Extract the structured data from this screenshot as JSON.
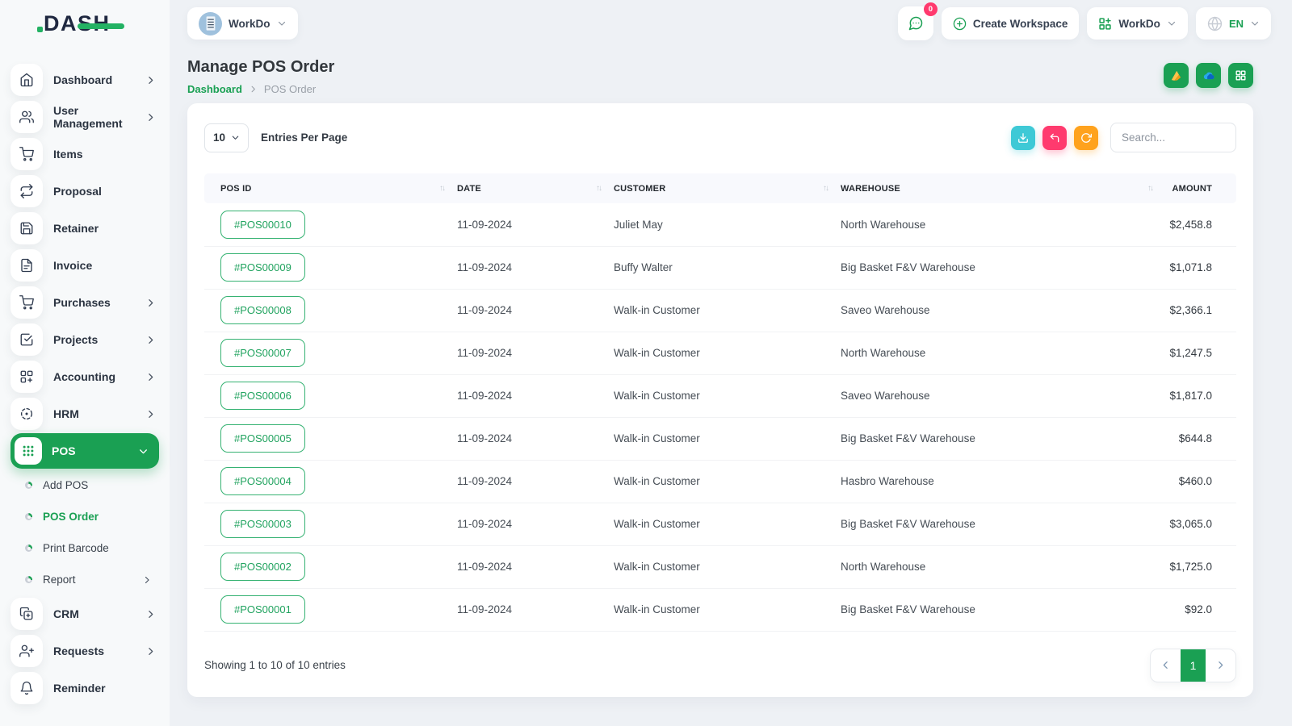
{
  "brand": {
    "logo_text": "DASH"
  },
  "topbar": {
    "workspace_switcher": {
      "label": "WorkDo",
      "avatar_icon": "building-icon"
    },
    "messages_badge": "0",
    "create_workspace_label": "Create Workspace",
    "company_dropdown_label": "WorkDo",
    "language": "EN"
  },
  "sidebar": {
    "items": [
      {
        "label": "Dashboard",
        "icon": "home-icon",
        "has_chevron": true
      },
      {
        "label": "User Management",
        "icon": "users-icon",
        "has_chevron": true
      },
      {
        "label": "Items",
        "icon": "cart-icon",
        "has_chevron": false
      },
      {
        "label": "Proposal",
        "icon": "repeat-icon",
        "has_chevron": false
      },
      {
        "label": "Retainer",
        "icon": "save-icon",
        "has_chevron": false
      },
      {
        "label": "Invoice",
        "icon": "file-icon",
        "has_chevron": false
      },
      {
        "label": "Purchases",
        "icon": "cart-icon",
        "has_chevron": true
      },
      {
        "label": "Projects",
        "icon": "check-square-icon",
        "has_chevron": true
      },
      {
        "label": "Accounting",
        "icon": "grid-plus-icon",
        "has_chevron": true
      },
      {
        "label": "HRM",
        "icon": "target-icon",
        "has_chevron": true
      },
      {
        "label": "POS",
        "icon": "grid-dots-icon",
        "has_chevron": true,
        "active": true
      }
    ],
    "pos_submenu": [
      {
        "label": "Add POS",
        "active": false
      },
      {
        "label": "POS Order",
        "active": true
      },
      {
        "label": "Print Barcode",
        "active": false
      },
      {
        "label": "Report",
        "active": false,
        "has_chevron": true
      }
    ],
    "items_bottom": [
      {
        "label": "CRM",
        "icon": "copy-plus-icon",
        "has_chevron": true
      },
      {
        "label": "Requests",
        "icon": "user-plus-icon",
        "has_chevron": true
      },
      {
        "label": "Reminder",
        "icon": "bell-icon",
        "has_chevron": false
      }
    ]
  },
  "page": {
    "title": "Manage POS Order",
    "breadcrumb": [
      "Dashboard",
      "POS Order"
    ],
    "header_buttons": [
      "google-drive-icon",
      "onedrive-icon",
      "grid-view-icon"
    ]
  },
  "toolbar": {
    "entries_per_page_value": "10",
    "entries_per_page_label": "Entries Per Page",
    "search_placeholder": "Search...",
    "buttons": [
      "download-icon",
      "undo-icon",
      "refresh-icon"
    ]
  },
  "table": {
    "columns": [
      "POS ID",
      "DATE",
      "CUSTOMER",
      "WAREHOUSE",
      "AMOUNT"
    ],
    "rows": [
      {
        "pos_id": "#POS00010",
        "date": "11-09-2024",
        "customer": "Juliet May",
        "warehouse": "North Warehouse",
        "amount": "$2,458.8"
      },
      {
        "pos_id": "#POS00009",
        "date": "11-09-2024",
        "customer": "Buffy Walter",
        "warehouse": "Big Basket F&V Warehouse",
        "amount": "$1,071.8"
      },
      {
        "pos_id": "#POS00008",
        "date": "11-09-2024",
        "customer": "Walk-in Customer",
        "warehouse": "Saveo Warehouse",
        "amount": "$2,366.1"
      },
      {
        "pos_id": "#POS00007",
        "date": "11-09-2024",
        "customer": "Walk-in Customer",
        "warehouse": "North Warehouse",
        "amount": "$1,247.5"
      },
      {
        "pos_id": "#POS00006",
        "date": "11-09-2024",
        "customer": "Walk-in Customer",
        "warehouse": "Saveo Warehouse",
        "amount": "$1,817.0"
      },
      {
        "pos_id": "#POS00005",
        "date": "11-09-2024",
        "customer": "Walk-in Customer",
        "warehouse": "Big Basket F&V Warehouse",
        "amount": "$644.8"
      },
      {
        "pos_id": "#POS00004",
        "date": "11-09-2024",
        "customer": "Walk-in Customer",
        "warehouse": "Hasbro Warehouse",
        "amount": "$460.0"
      },
      {
        "pos_id": "#POS00003",
        "date": "11-09-2024",
        "customer": "Walk-in Customer",
        "warehouse": "Big Basket F&V Warehouse",
        "amount": "$3,065.0"
      },
      {
        "pos_id": "#POS00002",
        "date": "11-09-2024",
        "customer": "Walk-in Customer",
        "warehouse": "North Warehouse",
        "amount": "$1,725.0"
      },
      {
        "pos_id": "#POS00001",
        "date": "11-09-2024",
        "customer": "Walk-in Customer",
        "warehouse": "Big Basket F&V Warehouse",
        "amount": "$92.0"
      }
    ],
    "footer": {
      "showing_text": "Showing 1 to 10 of 10 entries",
      "current_page": "1"
    }
  },
  "colors": {
    "primary": "#1aa053",
    "info": "#3ec9d6",
    "danger": "#ff3a6e",
    "warning": "#ffa21d"
  }
}
